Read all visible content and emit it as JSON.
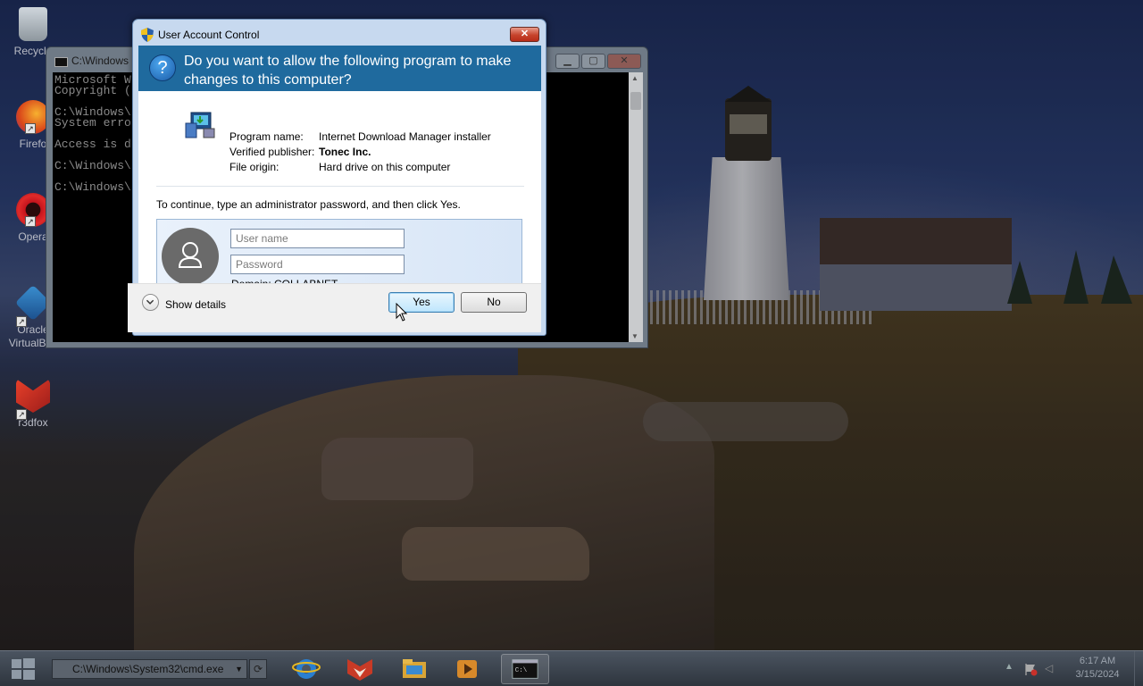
{
  "desktop": {
    "icons": [
      {
        "label": "Recycle"
      },
      {
        "label": "Firefo"
      },
      {
        "label": "Opera"
      },
      {
        "label": "Oracle VirtualBox"
      },
      {
        "label": "r3dfox"
      }
    ]
  },
  "cmd_window": {
    "title": "C:\\Windows",
    "console_lines": [
      "Microsoft W",
      "Copyright (",
      "",
      "C:\\Windows\\",
      "System erro",
      "",
      "Access is d",
      "",
      "C:\\Windows\\",
      "",
      "C:\\Windows\\"
    ]
  },
  "uac": {
    "title": "User Account Control",
    "close_glyph": "✕",
    "question_glyph": "?",
    "question": "Do you want to allow the following program to make changes to this computer?",
    "program_name_label": "Program name:",
    "program_name": "Internet Download Manager installer",
    "publisher_label": "Verified publisher:",
    "publisher": "Tonec Inc.",
    "origin_label": "File origin:",
    "origin": "Hard drive on this computer",
    "instruction": "To continue, type an administrator password, and then click Yes.",
    "username_placeholder": "User name",
    "password_placeholder": "Password",
    "domain": "Domain: COLLABNET",
    "show_details": "Show details",
    "yes_label": "Yes",
    "no_label": "No"
  },
  "taskbar": {
    "combo_text": "C:\\Windows\\System32\\cmd.exe",
    "combo_arrow": "▼",
    "refresh_glyph": "⟳",
    "tray_up": "▲",
    "tray_volume": "◁",
    "clock_time": "6:17 AM",
    "clock_date": "3/15/2024"
  },
  "colors": {
    "uac_header": "#1f6a9e",
    "uac_frame": "#c7d9ef",
    "close_red": "#c6432c"
  }
}
